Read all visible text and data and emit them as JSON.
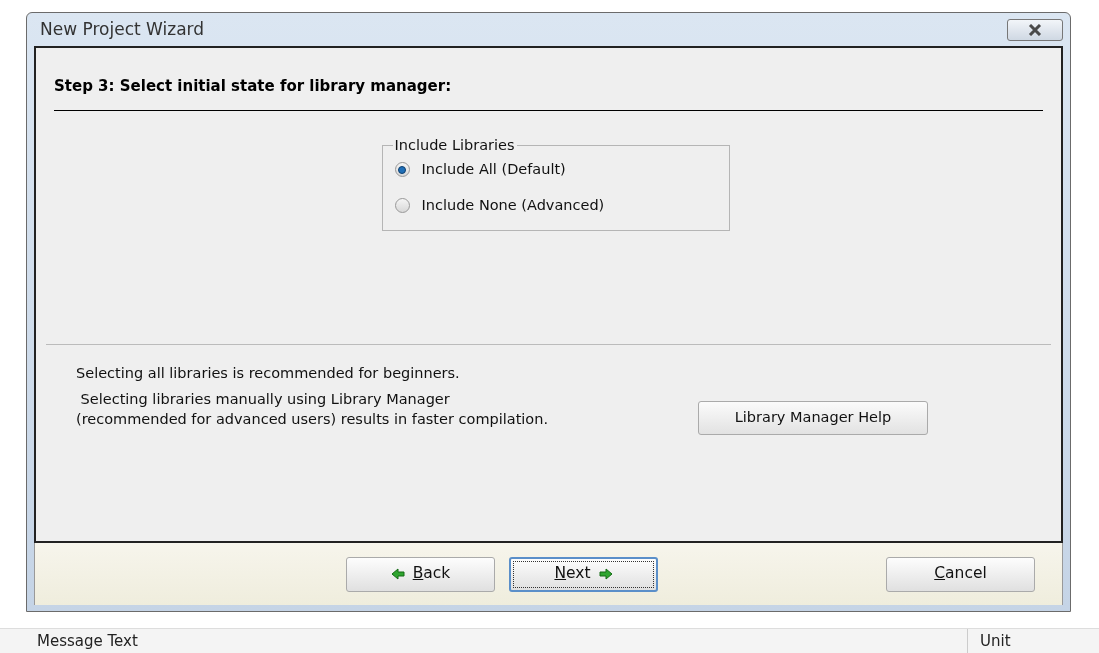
{
  "window": {
    "title": "New Project Wizard"
  },
  "step_heading": "Step 3: Select initial state for library manager:",
  "group": {
    "title": "Include Libraries",
    "options": [
      {
        "label": "Include All (Default)",
        "selected": true
      },
      {
        "label": "Include None (Advanced)",
        "selected": false
      }
    ]
  },
  "notes": [
    "Selecting all libraries is recommended for beginners.",
    " Selecting libraries manually using Library Manager\n(recommended for advanced users) results in faster compilation."
  ],
  "help_button": "Library Manager Help",
  "buttons": [
    {
      "kind": "back",
      "label": "Back",
      "focused": false
    },
    {
      "kind": "next",
      "label": "Next",
      "focused": true
    },
    {
      "kind": "cancel",
      "label": "Cancel",
      "focused": false
    }
  ],
  "status_bar": {
    "columns": [
      "Message Text",
      "Unit"
    ]
  }
}
